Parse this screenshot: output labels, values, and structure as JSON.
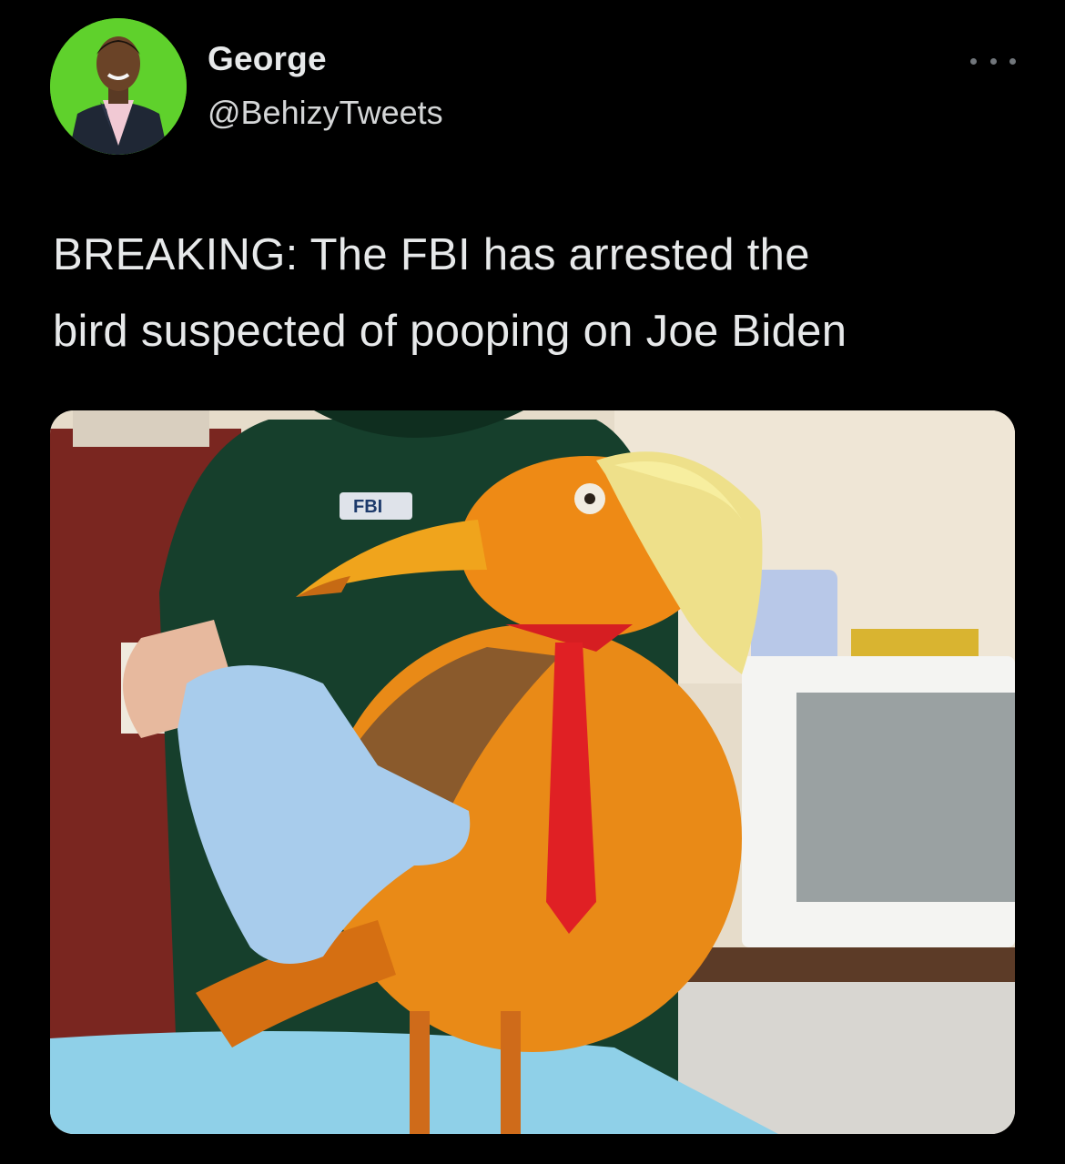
{
  "tweet": {
    "author": {
      "display_name": "George",
      "handle": "@BehizyTweets",
      "avatar_icon": "profile-avatar"
    },
    "more_icon": "ellipsis-icon",
    "text": "BREAKING: The FBI has arrested the\nbird suspected of pooping on Joe Biden",
    "media": {
      "badge_text": "FBI"
    }
  },
  "colors": {
    "background": "#000000",
    "primary_text": "#e7e9ea",
    "secondary_text": "#71767b",
    "avatar_bg": "#5fd12c"
  }
}
